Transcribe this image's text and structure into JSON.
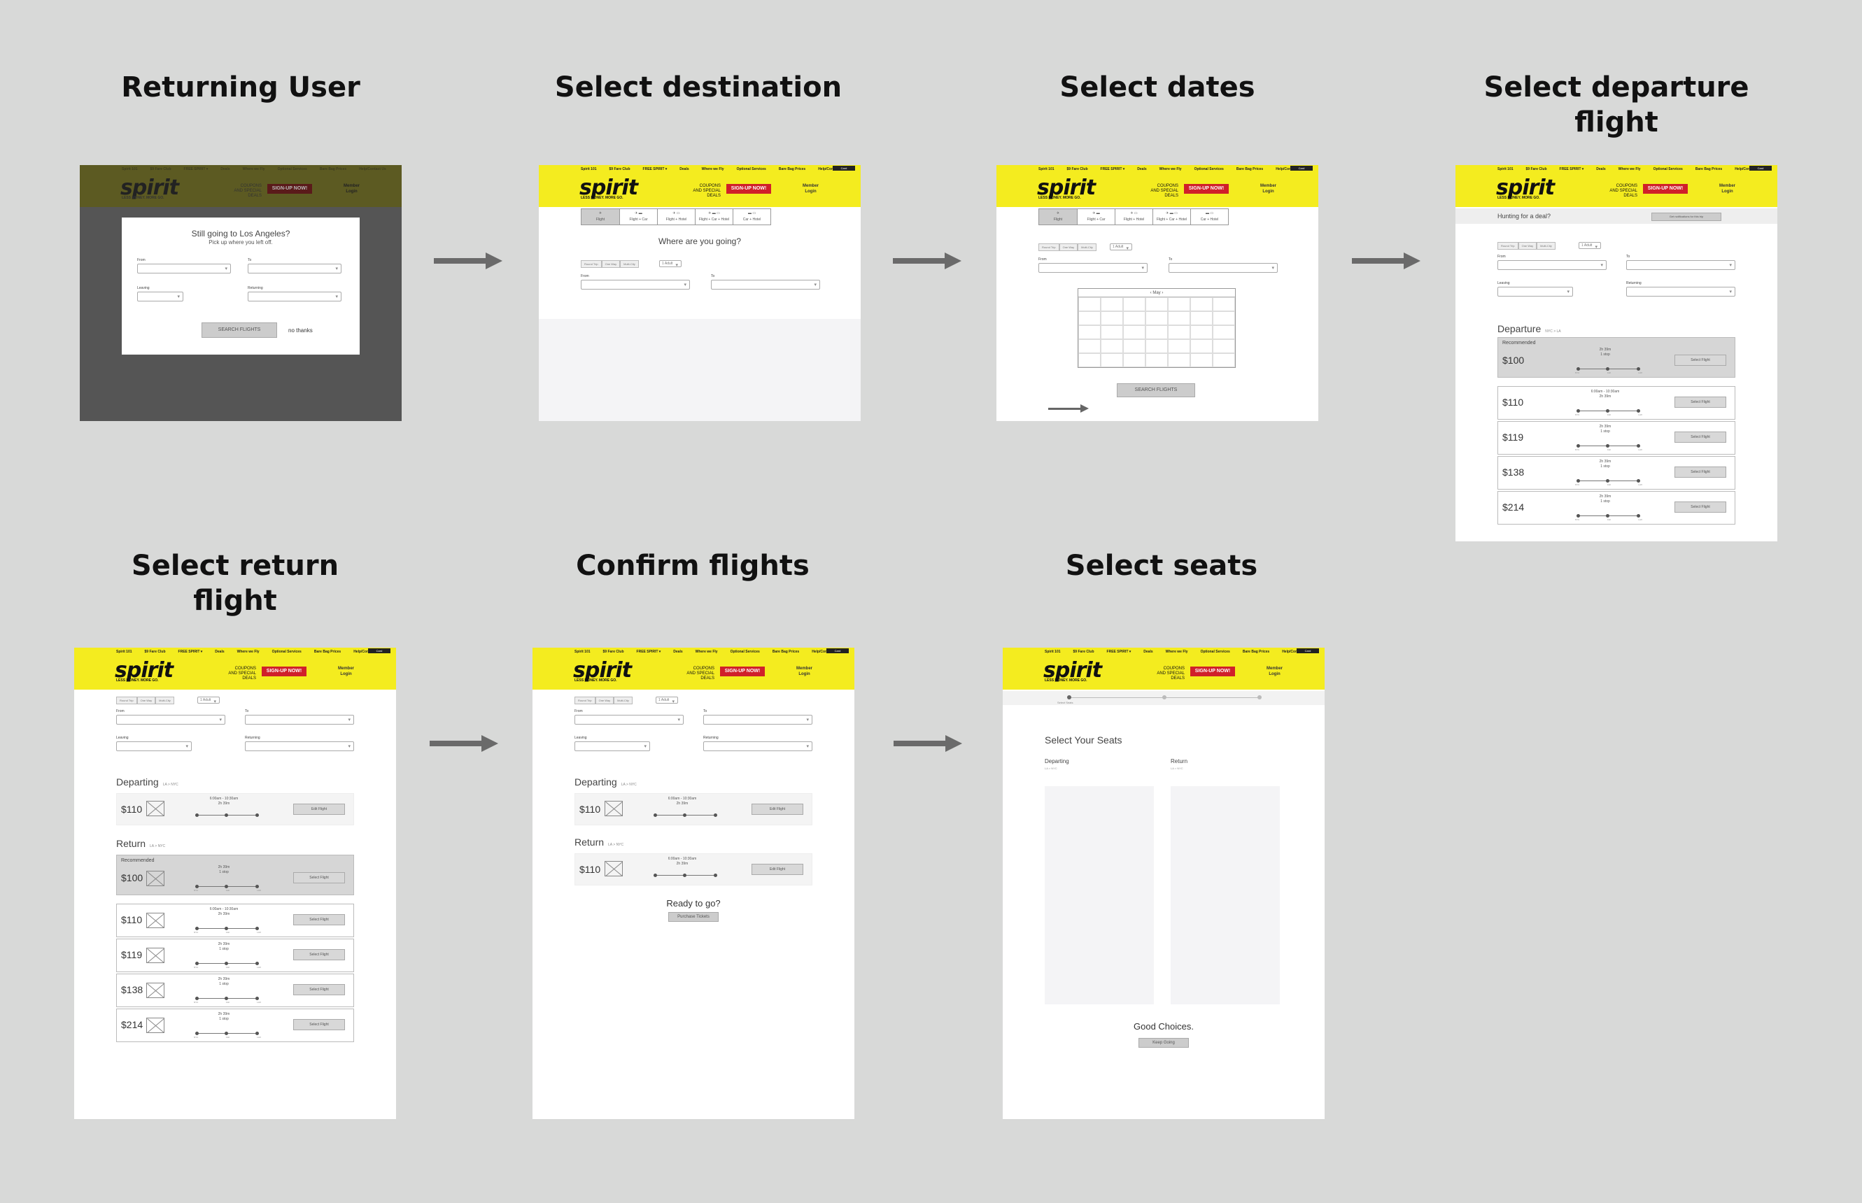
{
  "titles": {
    "returning": "Returning User",
    "destination": "Select destination",
    "dates": "Select dates",
    "departure": "Select departure flight",
    "return": "Select return flight",
    "confirm": "Confirm flights",
    "seats": "Select seats"
  },
  "header": {
    "logo": "spirit",
    "tagline": "LESS MONEY. MORE GO.",
    "coupon": "COUPONS AND SPECIAL DEALS",
    "signup": "SIGN-UP NOW!",
    "member": "Member",
    "login": "Login",
    "cobrand": "Card",
    "nav": [
      "Spirit 101",
      "$9 Fare Club",
      "FREE SPIRIT ▾",
      "Deals",
      "Where we Fly",
      "Optional Services",
      "Bare Bag Prices",
      "Help/Contact Us"
    ]
  },
  "tabs": [
    "Flight",
    "Flight + Car",
    "Flight + Hotel",
    "Flight + Car + Hotel",
    "Car + Hotel"
  ],
  "returning": {
    "heading": "Still going to Los Angeles?",
    "sub": "Pick up where you left off.",
    "from": "From",
    "to": "To",
    "leaving": "Leaving",
    "returning": "Returning",
    "search": "SEARCH FLIGHTS",
    "nothanks": "no thanks"
  },
  "destination": {
    "heading": "Where are you going?",
    "from": "From",
    "to": "To",
    "trip": [
      "Round Trip",
      "One Way",
      "Multi-City"
    ],
    "pax": "1 Adult"
  },
  "dates": {
    "from": "From",
    "to": "To",
    "month": "May",
    "search": "SEARCH FLIGHTS",
    "trip": [
      "Round Trip",
      "One Way",
      "Multi-City"
    ],
    "pax": "1 Adult"
  },
  "departure": {
    "deal": "Hunting for a deal?",
    "notify": "Get notifications for this trip",
    "from": "From",
    "to": "To",
    "leaving": "Leaving",
    "returning": "Returning",
    "section": "Departure",
    "section_sub": "NYC > LA",
    "recommended": "Recommended",
    "flights": [
      {
        "price": "$100",
        "time": "",
        "dur": "2h 39m",
        "stops": "1 stop",
        "btn": "Select Flight"
      },
      {
        "price": "$110",
        "time": "6:00am - 10:30am",
        "dur": "2h 39m",
        "stops": "",
        "btn": "Select Flight"
      },
      {
        "price": "$119",
        "time": "",
        "dur": "2h 39m",
        "stops": "1 stop",
        "btn": "Select Flight"
      },
      {
        "price": "$138",
        "time": "",
        "dur": "2h 39m",
        "stops": "1 stop",
        "btn": "Select Flight"
      },
      {
        "price": "$214",
        "time": "",
        "dur": "2h 39m",
        "stops": "1 stop",
        "btn": "Select Flight"
      }
    ],
    "codes": [
      "NYC",
      "CHI",
      "LAX"
    ]
  },
  "returnflight": {
    "departing": "Departing",
    "departing_sub": "LA > NYC",
    "dep_price": "$110",
    "dep_time": "6:00am - 10:30am",
    "dep_dur": "2h 39m",
    "edit": "Edit Flight",
    "return": "Return",
    "return_sub": "LA > NYC",
    "recommended": "Recommended",
    "flights": [
      {
        "price": "$100",
        "time": "",
        "dur": "2h 39m",
        "stops": "1 stop",
        "btn": "Select Flight"
      },
      {
        "price": "$110",
        "time": "6:00am - 10:30am",
        "dur": "2h 39m",
        "stops": "",
        "btn": "Select Flight"
      },
      {
        "price": "$119",
        "time": "",
        "dur": "2h 39m",
        "stops": "1 stop",
        "btn": "Select Flight"
      },
      {
        "price": "$138",
        "time": "",
        "dur": "2h 39m",
        "stops": "1 stop",
        "btn": "Select Flight"
      },
      {
        "price": "$214",
        "time": "",
        "dur": "2h 39m",
        "stops": "1 stop",
        "btn": "Select Flight"
      }
    ]
  },
  "confirm": {
    "departing": "Departing",
    "departing_sub": "LA > NYC",
    "return": "Return",
    "return_sub": "LA > NYC",
    "price1": "$110",
    "price2": "$110",
    "time": "6:00am - 10:30am",
    "dur": "2h 39m",
    "edit": "Edit Flight",
    "ready": "Ready to go?",
    "purchase": "Purchase Tickets"
  },
  "seats": {
    "steps": [
      "Select Seats",
      "",
      ""
    ],
    "heading": "Select Your Seats",
    "departing": "Departing",
    "departing_sub": "LA > NYC",
    "return": "Return",
    "return_sub": "LA > NYC",
    "good": "Good Choices.",
    "keep": "Keep Going"
  }
}
